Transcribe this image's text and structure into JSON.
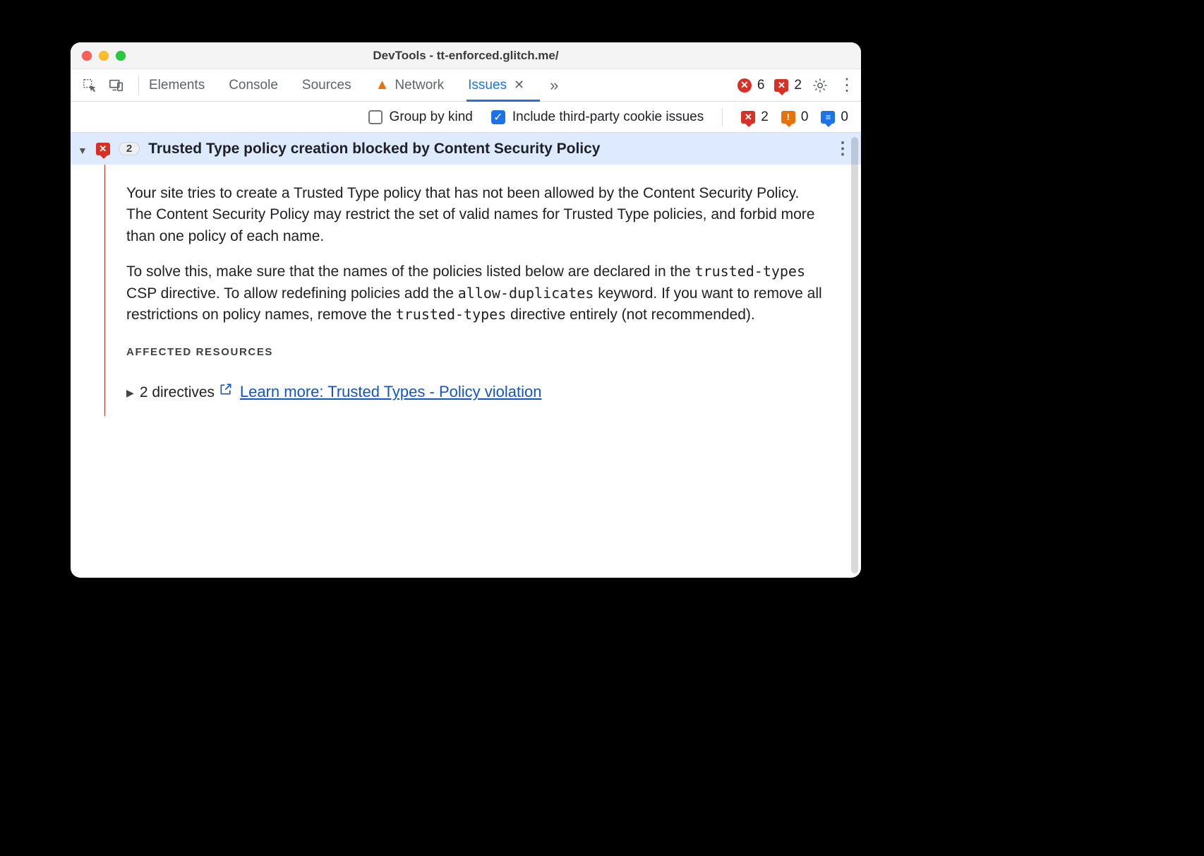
{
  "window": {
    "title": "DevTools - tt-enforced.glitch.me/"
  },
  "tabs": {
    "items": [
      "Elements",
      "Console",
      "Sources",
      "Network",
      "Issues"
    ],
    "active_index": 4,
    "network_has_warning": true
  },
  "toolbar_right": {
    "errors_count": "6",
    "issues_count": "2"
  },
  "filter": {
    "group_by_kind": {
      "label": "Group by kind",
      "checked": false
    },
    "third_party": {
      "label": "Include third-party cookie issues",
      "checked": true
    }
  },
  "issue_counts": {
    "error": "2",
    "warning": "0",
    "info": "0"
  },
  "issue": {
    "count_badge": "2",
    "title": "Trusted Type policy creation blocked by Content Security Policy",
    "para1": "Your site tries to create a Trusted Type policy that has not been allowed by the Content Security Policy. The Content Security Policy may restrict the set of valid names for Trusted Type policies, and forbid more than one policy of each name.",
    "para2_a": "To solve this, make sure that the names of the policies listed below are declared in the ",
    "code1": "trusted-types",
    "para2_b": " CSP directive. To allow redefining policies add the ",
    "code2": "allow-duplicates",
    "para2_c": " keyword. If you want to remove all restrictions on policy names, remove the ",
    "code3": "trusted-types",
    "para2_d": " directive entirely (not recommended).",
    "affected_heading": "Affected Resources",
    "affected_item": "2 directives",
    "learn_more": "Learn more: Trusted Types - Policy violation"
  }
}
